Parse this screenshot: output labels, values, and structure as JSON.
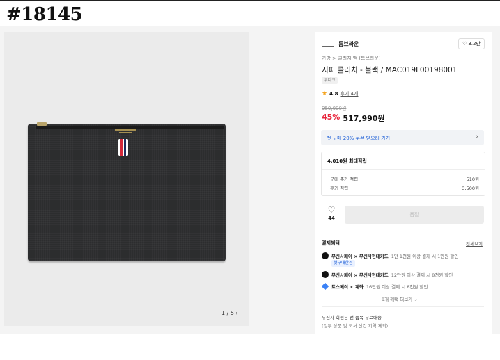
{
  "page_id": "#18145",
  "gallery": {
    "pager": "1 / 5 ›"
  },
  "brand": {
    "name": "톰브라운",
    "likes": "3.2만"
  },
  "product": {
    "breadcrumb": "가방 > 클러치 백 (톰브라운)",
    "title": "지퍼 클러치 - 블랙 / MAC019L00198001",
    "chip": "부티크",
    "rating": "4.8",
    "review_count": "후기 4개",
    "original_price": "950,000원",
    "discount": "45%",
    "price": "517,990원"
  },
  "coupon": {
    "text": "첫 구매 20% 쿠폰 받으러 가기",
    "arrow": "›"
  },
  "points": {
    "head": "4,010원 최대적립",
    "rows": [
      {
        "label": "· 구매 추가 적립",
        "value": "510원"
      },
      {
        "label": "· 후기 적립",
        "value": "3,500원"
      }
    ]
  },
  "like_button": {
    "icon": "♡",
    "count": "44"
  },
  "buy_button": {
    "label": "품절"
  },
  "benefits": {
    "heading": "결제혜택",
    "see_all": "전체보기",
    "items": [
      {
        "bold": "무신사페이 × 무신사현대카드",
        "text": "1만 1천원 이상 결제 시 1만원 할인",
        "tag": "첫구매한정"
      },
      {
        "bold": "무신사페이 × 무신사현대카드",
        "text": "12만원 이상 결제 시 8천원 할인"
      },
      {
        "bold": "토스페이 × 계좌",
        "text": "16만원 이상 결제 시 8천원 할인"
      }
    ],
    "more": "9개 혜택 더보기 ⌵"
  },
  "shipping": {
    "line1": "무신사 회원은 전 품목 무료배송",
    "line2": "(일부 상품 및 도서 산간 지역 제외)"
  },
  "colors": {
    "discount": "#e8253b",
    "link_blue": "#1a5cd6",
    "tab_red": "#d3293a",
    "tab_navy": "#1f2d5c"
  }
}
